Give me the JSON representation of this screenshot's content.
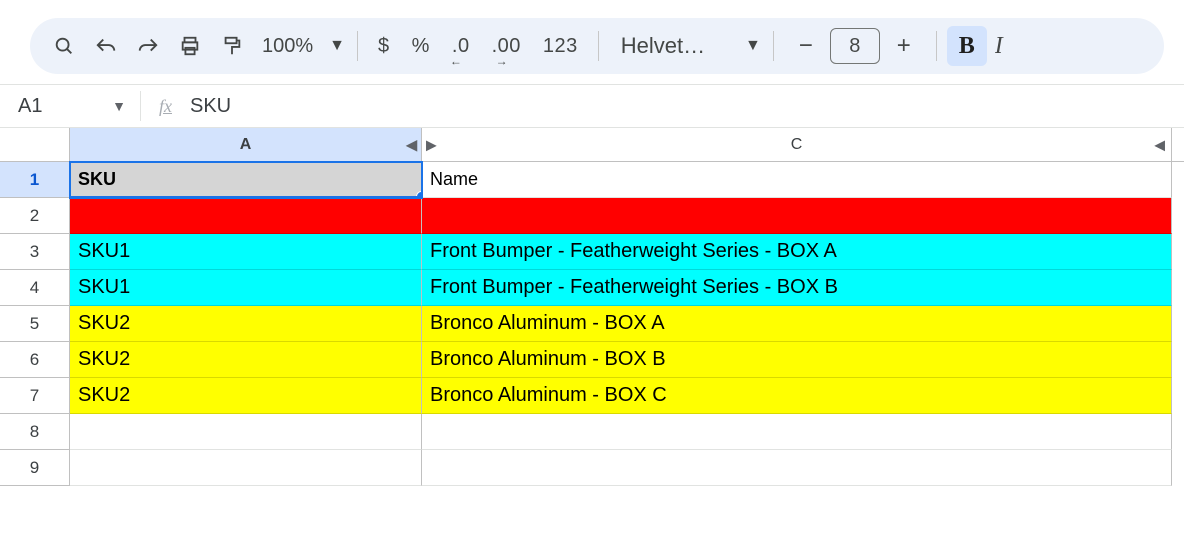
{
  "toolbar": {
    "zoom": "100%",
    "currency": "$",
    "percent": "%",
    "dec_decrease": ".0",
    "dec_increase": ".00",
    "numfmt": "123",
    "font_name": "Helvet…",
    "font_size": "8",
    "bold": "B",
    "italic_hint": "I"
  },
  "namebox": {
    "cell": "A1"
  },
  "formula_bar": {
    "label": "fx",
    "value": "SKU"
  },
  "columns": {
    "A": "A",
    "C": "C"
  },
  "row_numbers": [
    "1",
    "2",
    "3",
    "4",
    "5",
    "6",
    "7",
    "8",
    "9"
  ],
  "cells": {
    "r1": {
      "A": "SKU",
      "C": "Name"
    },
    "r2": {
      "A": "",
      "C": ""
    },
    "r3": {
      "A": "SKU1",
      "C": "Front Bumper - Featherweight Series - BOX A"
    },
    "r4": {
      "A": "SKU1",
      "C": "Front Bumper - Featherweight Series - BOX B"
    },
    "r5": {
      "A": "SKU2",
      "C": "Bronco Aluminum - BOX A"
    },
    "r6": {
      "A": "SKU2",
      "C": "Bronco Aluminum - BOX B"
    },
    "r7": {
      "A": "SKU2",
      "C": "Bronco Aluminum - BOX C"
    },
    "r8": {
      "A": "",
      "C": ""
    },
    "r9": {
      "A": "",
      "C": ""
    }
  },
  "chart_data": {
    "type": "table",
    "columns": [
      "SKU",
      "Name"
    ],
    "rows": [
      {
        "SKU": "",
        "Name": "",
        "fill": "#ff0000"
      },
      {
        "SKU": "SKU1",
        "Name": "Front Bumper - Featherweight Series - BOX A",
        "fill": "#00ffff"
      },
      {
        "SKU": "SKU1",
        "Name": "Front Bumper - Featherweight Series - BOX B",
        "fill": "#00ffff"
      },
      {
        "SKU": "SKU2",
        "Name": "Bronco Aluminum - BOX A",
        "fill": "#ffff00"
      },
      {
        "SKU": "SKU2",
        "Name": "Bronco Aluminum - BOX B",
        "fill": "#ffff00"
      },
      {
        "SKU": "SKU2",
        "Name": "Bronco Aluminum - BOX C",
        "fill": "#ffff00"
      }
    ],
    "title": "",
    "selected_cell": "A1"
  }
}
